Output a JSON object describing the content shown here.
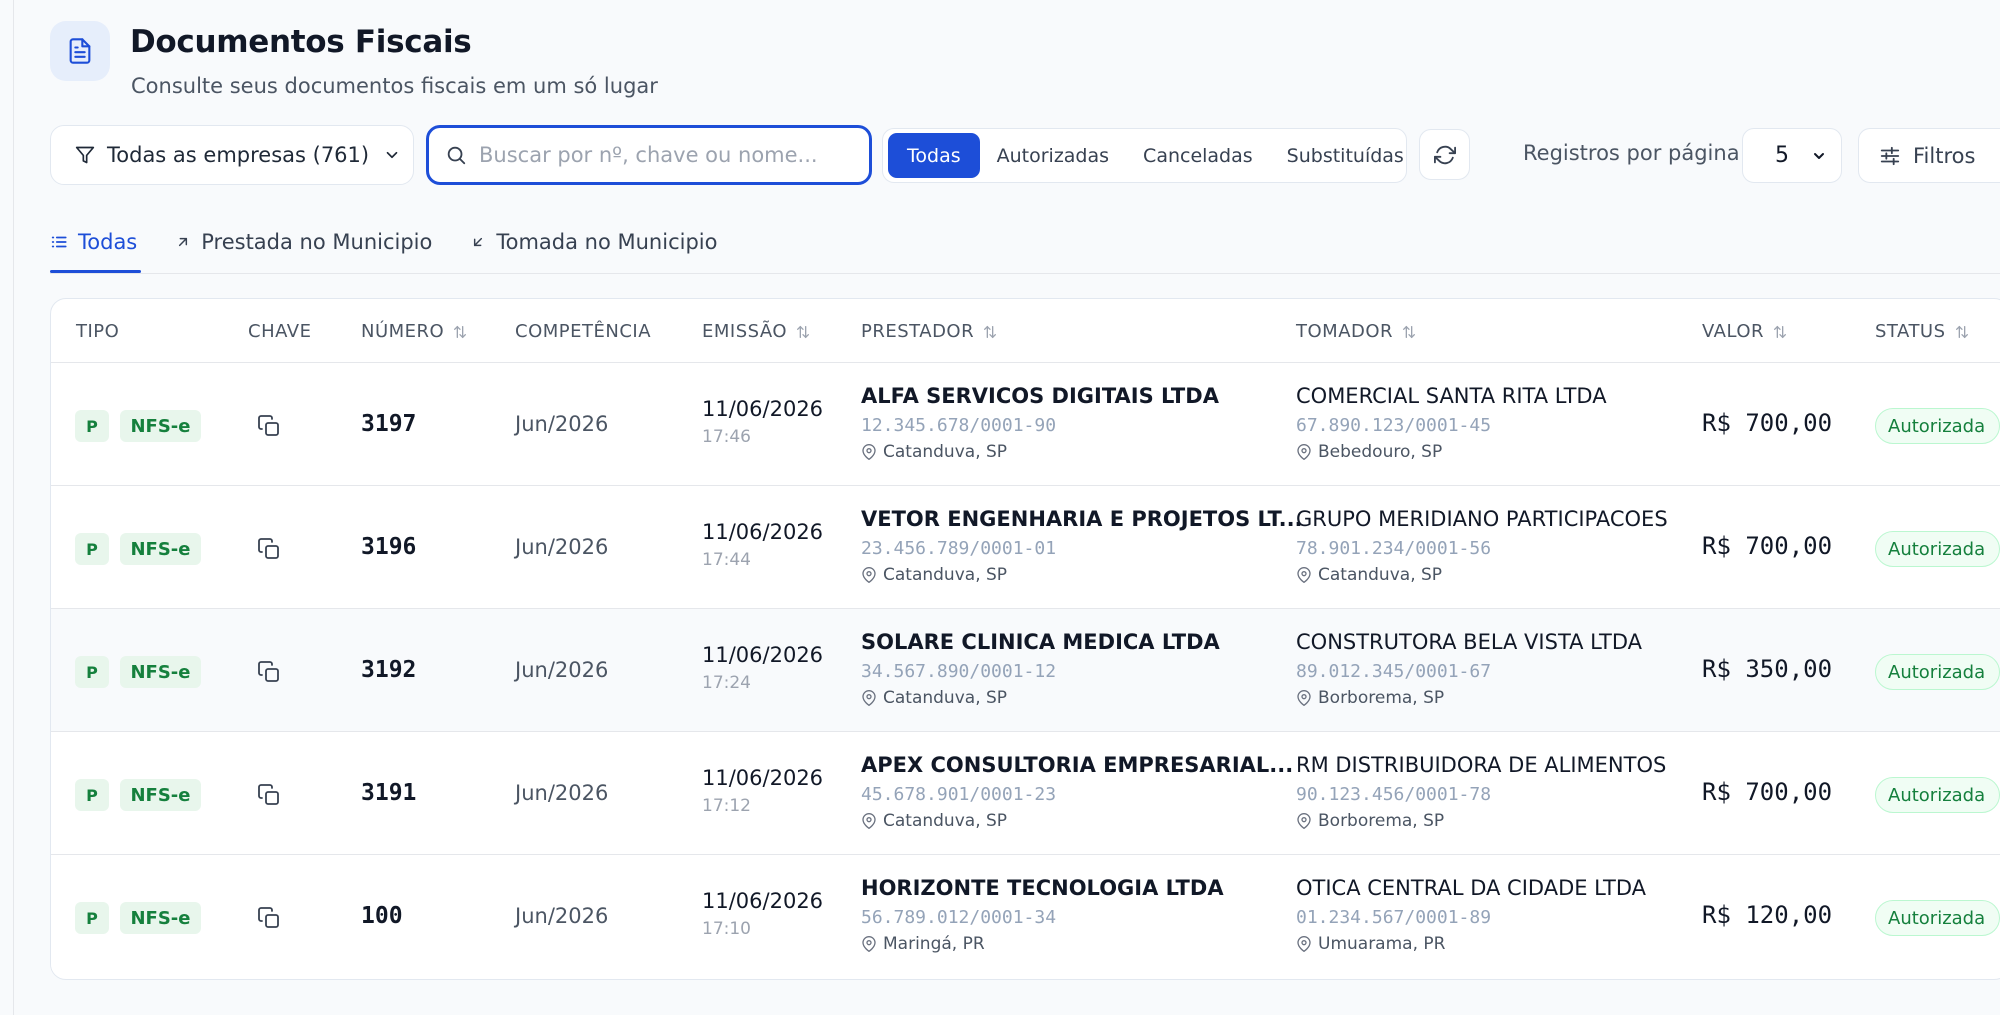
{
  "header": {
    "title": "Documentos Fiscais",
    "subtitle": "Consulte seus documentos fiscais em um só lugar"
  },
  "toolbar": {
    "company_filter": "Todas as empresas (761)",
    "search_placeholder": "Buscar por nº, chave ou nome...",
    "status_options": [
      "Todas",
      "Autorizadas",
      "Canceladas",
      "Substituídas"
    ],
    "status_selected": "Todas",
    "per_page_label": "Registros por página",
    "per_page_value": "5",
    "filters_label": "Filtros"
  },
  "tabs": [
    {
      "label": "Todas",
      "icon": "list-icon",
      "active": true
    },
    {
      "label": "Prestada no Municipio",
      "icon": "arrow-up-right-icon",
      "active": false
    },
    {
      "label": "Tomada no Municipio",
      "icon": "arrow-down-left-icon",
      "active": false
    }
  ],
  "table": {
    "columns": [
      "TIPO",
      "CHAVE",
      "NÚMERO",
      "COMPETÊNCIA",
      "EMISSÃO",
      "PRESTADOR",
      "TOMADOR",
      "VALOR",
      "STATUS"
    ],
    "sortable": [
      "NÚMERO",
      "EMISSÃO",
      "PRESTADOR",
      "TOMADOR",
      "VALOR",
      "STATUS"
    ],
    "rows": [
      {
        "tipo_badge": "P",
        "tipo": "NFS-e",
        "numero": "3197",
        "competencia": "Jun/2026",
        "emissao_data": "11/06/2026",
        "emissao_hora": "17:46",
        "prestador": {
          "nome": "ALFA SERVICOS DIGITAIS LTDA",
          "cnpj": "12.345.678/0001-90",
          "local": "Catanduva, SP"
        },
        "tomador": {
          "nome": "COMERCIAL SANTA RITA LTDA",
          "cnpj": "67.890.123/0001-45",
          "local": "Bebedouro, SP"
        },
        "valor": "R$ 700,00",
        "status": "Autorizada"
      },
      {
        "tipo_badge": "P",
        "tipo": "NFS-e",
        "numero": "3196",
        "competencia": "Jun/2026",
        "emissao_data": "11/06/2026",
        "emissao_hora": "17:44",
        "prestador": {
          "nome": "VETOR ENGENHARIA E PROJETOS LT...",
          "cnpj": "23.456.789/0001-01",
          "local": "Catanduva, SP"
        },
        "tomador": {
          "nome": "GRUPO MERIDIANO PARTICIPACOES",
          "cnpj": "78.901.234/0001-56",
          "local": "Catanduva, SP"
        },
        "valor": "R$ 700,00",
        "status": "Autorizada"
      },
      {
        "tipo_badge": "P",
        "tipo": "NFS-e",
        "numero": "3192",
        "competencia": "Jun/2026",
        "emissao_data": "11/06/2026",
        "emissao_hora": "17:24",
        "prestador": {
          "nome": "SOLARE CLINICA MEDICA LTDA",
          "cnpj": "34.567.890/0001-12",
          "local": "Catanduva, SP"
        },
        "tomador": {
          "nome": "CONSTRUTORA BELA VISTA LTDA",
          "cnpj": "89.012.345/0001-67",
          "local": "Borborema, SP"
        },
        "valor": "R$ 350,00",
        "status": "Autorizada"
      },
      {
        "tipo_badge": "P",
        "tipo": "NFS-e",
        "numero": "3191",
        "competencia": "Jun/2026",
        "emissao_data": "11/06/2026",
        "emissao_hora": "17:12",
        "prestador": {
          "nome": "APEX CONSULTORIA EMPRESARIAL...",
          "cnpj": "45.678.901/0001-23",
          "local": "Catanduva, SP"
        },
        "tomador": {
          "nome": "RM DISTRIBUIDORA DE ALIMENTOS",
          "cnpj": "90.123.456/0001-78",
          "local": "Borborema, SP"
        },
        "valor": "R$ 700,00",
        "status": "Autorizada"
      },
      {
        "tipo_badge": "P",
        "tipo": "NFS-e",
        "numero": "100",
        "competencia": "Jun/2026",
        "emissao_data": "11/06/2026",
        "emissao_hora": "17:10",
        "prestador": {
          "nome": "HORIZONTE TECNOLOGIA LTDA",
          "cnpj": "56.789.012/0001-34",
          "local": "Maringá, PR"
        },
        "tomador": {
          "nome": "OTICA CENTRAL DA CIDADE LTDA",
          "cnpj": "01.234.567/0001-89",
          "local": "Umuarama, PR"
        },
        "valor": "R$ 120,00",
        "status": "Autorizada"
      }
    ]
  },
  "colors": {
    "accent": "#1d4ed8",
    "success": "#15803d",
    "success_bg": "#e8f6ec"
  }
}
